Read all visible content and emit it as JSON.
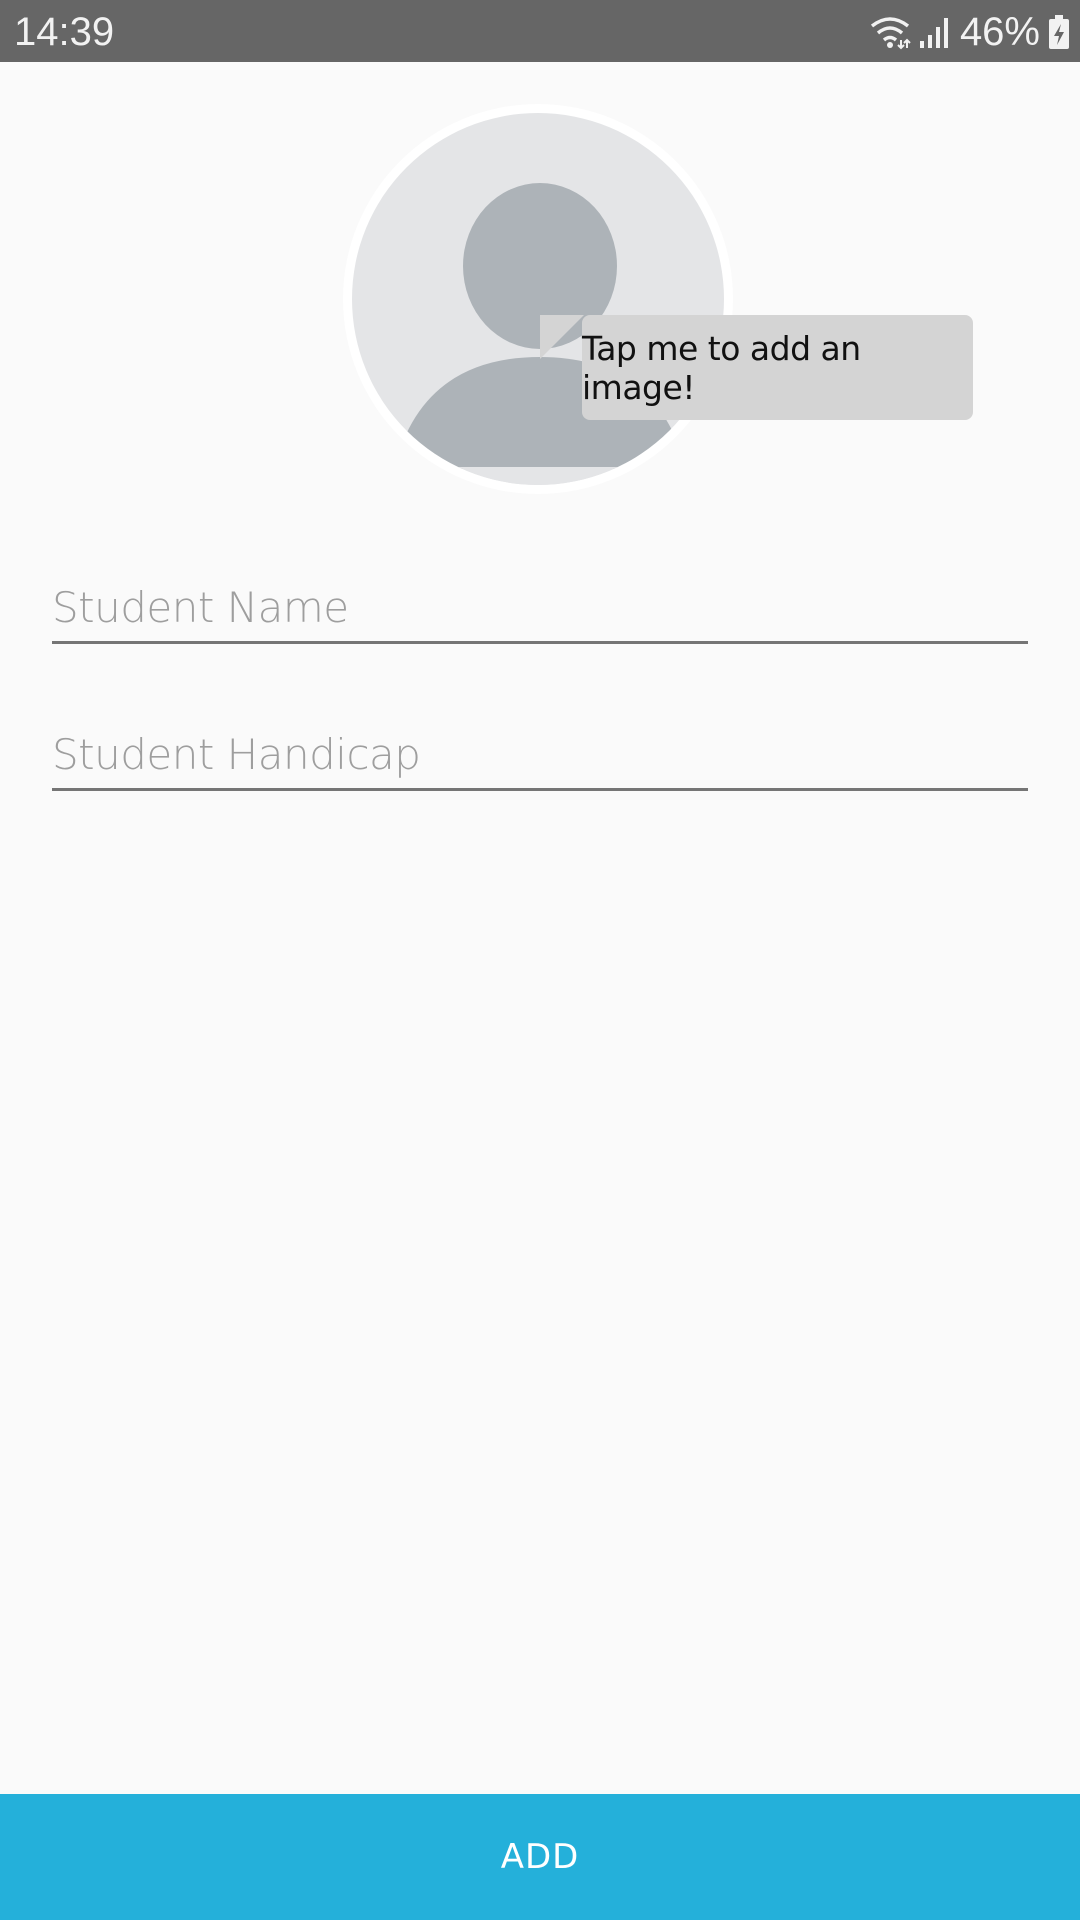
{
  "status_bar": {
    "time": "14:39",
    "battery_percent": "46%",
    "icons": [
      "wifi-icon",
      "signal-icon",
      "battery-charging-icon"
    ]
  },
  "avatar": {
    "icon": "person-placeholder-icon"
  },
  "tooltip": {
    "text": "Tap me to add an image!"
  },
  "form": {
    "student_name": {
      "value": "",
      "placeholder": "Student Name"
    },
    "student_handicap": {
      "value": "",
      "placeholder": "Student Handicap"
    }
  },
  "add_button": {
    "label": "ADD"
  },
  "colors": {
    "status_bar": "#666666",
    "background": "#fafafa",
    "accent": "#24b0da",
    "tooltip": "#d4d4d4",
    "avatar_bg": "#e4e5e7",
    "avatar_figure": "#adb3b8"
  }
}
